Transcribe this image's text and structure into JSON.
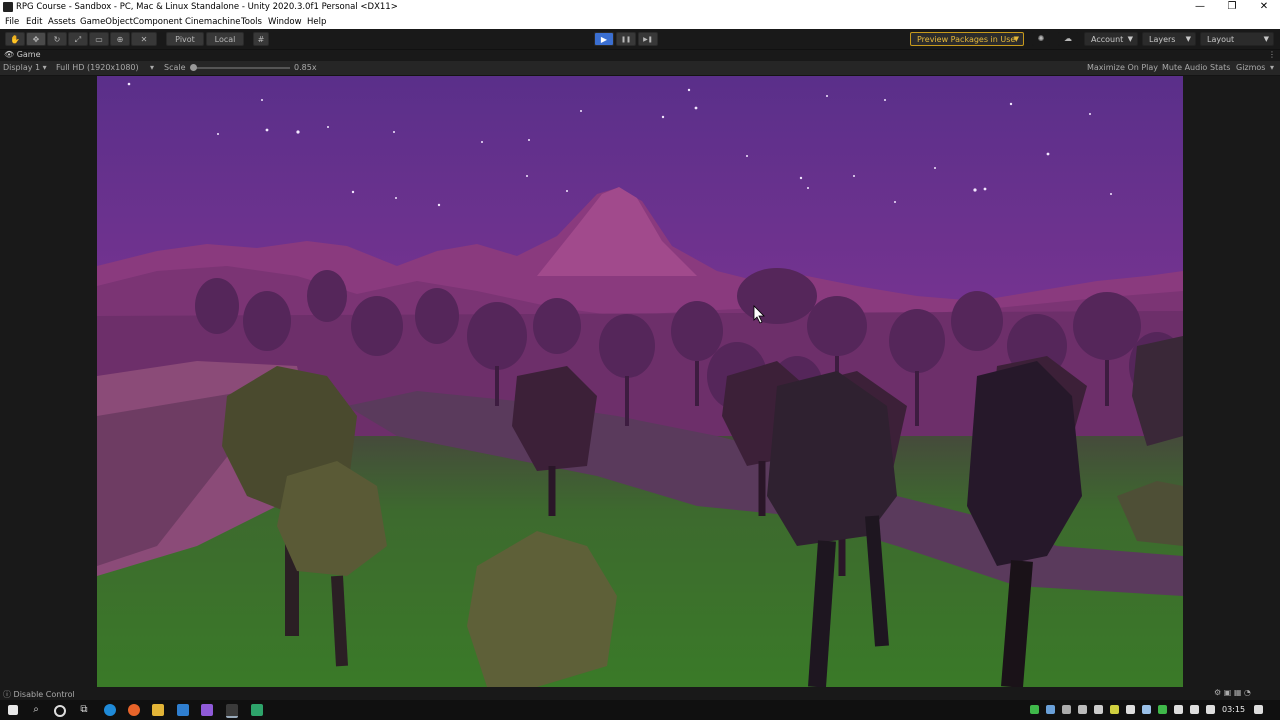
{
  "window": {
    "title": "RPG Course - Sandbox - PC, Mac & Linux Standalone - Unity 2020.3.0f1 Personal <DX11>",
    "minimize": "—",
    "restore": "❐",
    "close": "✕"
  },
  "menu": [
    "File",
    "Edit",
    "Assets",
    "GameObject",
    "Component",
    "Cinemachine",
    "Tools",
    "Window",
    "Help"
  ],
  "toolbar": {
    "pivot_label": "Pivot",
    "local_label": "Local",
    "preview_packages_label": "Preview Packages in Use",
    "account_label": "Account",
    "layers_label": "Layers",
    "layout_label": "Layout",
    "play_icon": "▶",
    "pause_icon": "❚❚",
    "step_icon": "▶❚"
  },
  "game_tab": {
    "label": "Game"
  },
  "game_bar": {
    "display": "Display 1",
    "resolution": "Full HD (1920x1080)",
    "scale_label": "Scale",
    "scale_value": "0.85x",
    "maximize_on_play": "Maximize On Play",
    "mute_audio": "Mute Audio",
    "stats": "Stats",
    "gizmos": "Gizmos"
  },
  "status": {
    "text": "Disable Control"
  },
  "taskbar": {
    "clock": "03:15"
  },
  "colors": {
    "accent_play": "#3b6fd1",
    "preview_warning": "#e6b93a",
    "sky_top": "#6a2f8f",
    "sky_horizon": "#c2459a",
    "ground": "#3f7a2a"
  }
}
